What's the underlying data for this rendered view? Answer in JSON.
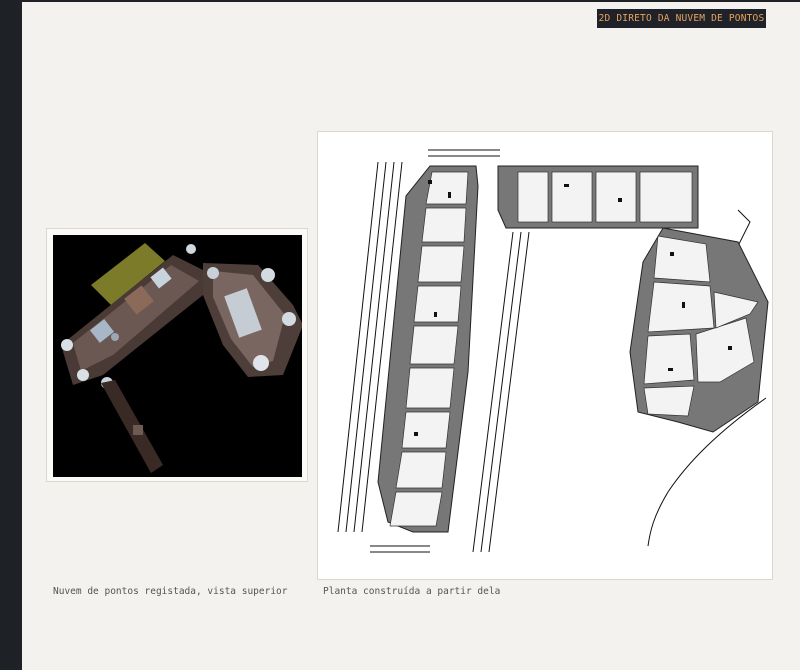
{
  "header": {
    "badge_label": "2D DIRETO DA NUVEM DE PONTOS"
  },
  "figures": {
    "point_cloud": {
      "caption": "Nuvem de pontos registada, vista superior"
    },
    "floor_plan": {
      "caption": "Planta construída a partir dela"
    }
  },
  "colors": {
    "sidebar": "#1e2227",
    "page_background": "#f4f2ee",
    "badge_background": "#1f2329",
    "badge_text": "#e8a25c",
    "caption_text": "#555555"
  }
}
